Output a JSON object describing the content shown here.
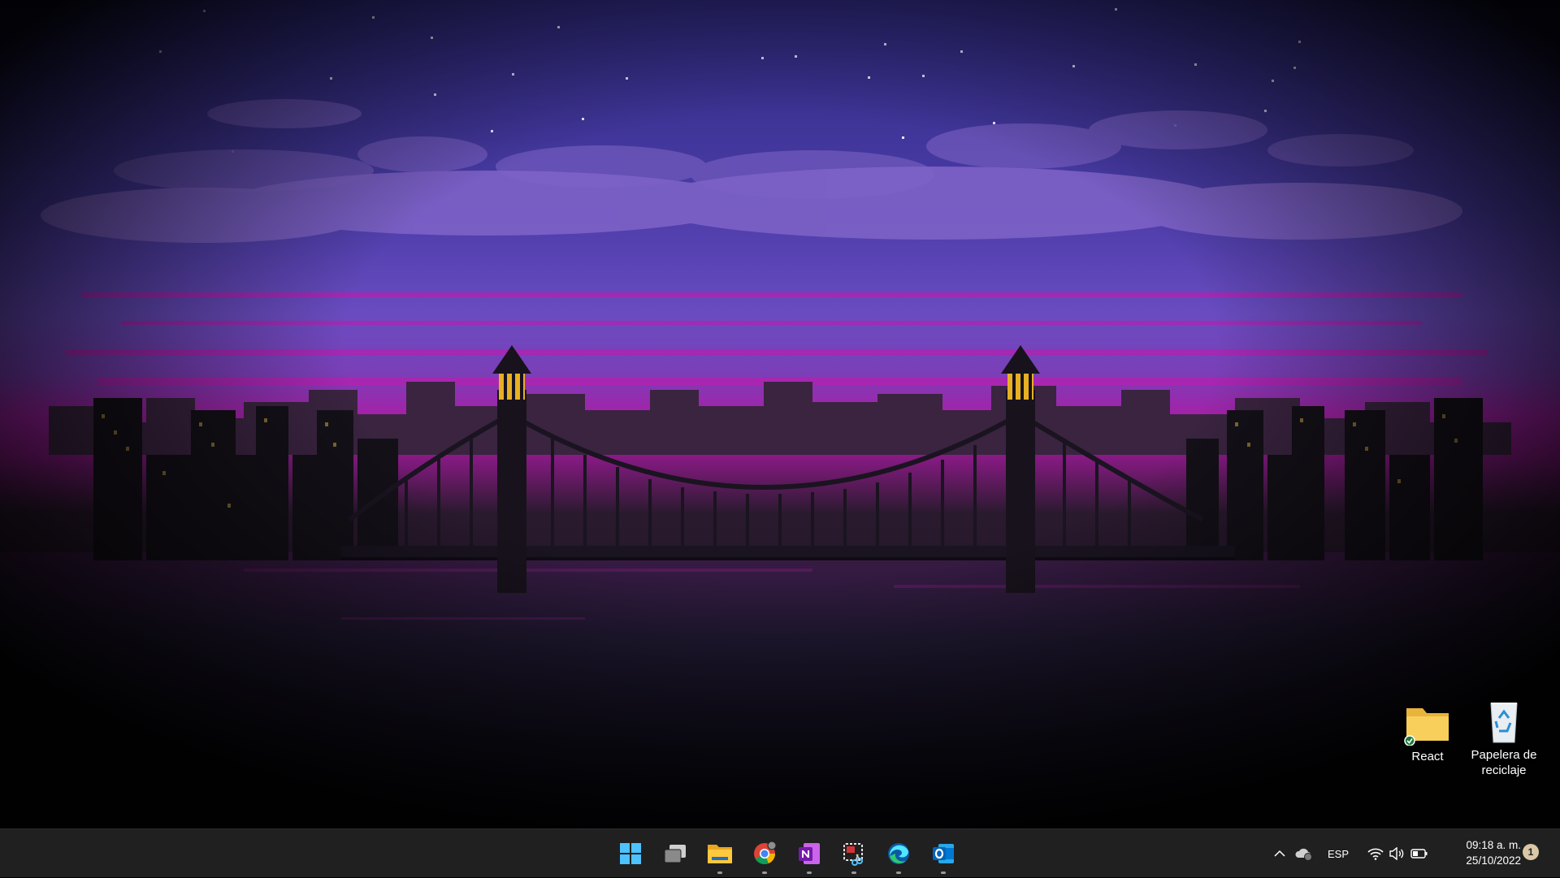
{
  "desktop": {
    "icons": [
      {
        "label": "React"
      },
      {
        "label": "Papelera de reciclaje"
      }
    ]
  },
  "taskbar": {
    "apps": [
      {
        "name": "start-icon"
      },
      {
        "name": "task-view-icon"
      },
      {
        "name": "file-explorer-icon"
      },
      {
        "name": "chrome-icon"
      },
      {
        "name": "onenote-icon"
      },
      {
        "name": "snipping-tool-icon"
      },
      {
        "name": "edge-icon"
      },
      {
        "name": "outlook-icon"
      }
    ],
    "tray": {
      "language": "ESP",
      "time": "09:18 a. m.",
      "date": "25/10/2022",
      "notification_count": "1"
    }
  },
  "colors": {
    "taskbar": "#202020",
    "sky_top": "#3b2f8a",
    "horizon_magenta": "#b0159f"
  }
}
